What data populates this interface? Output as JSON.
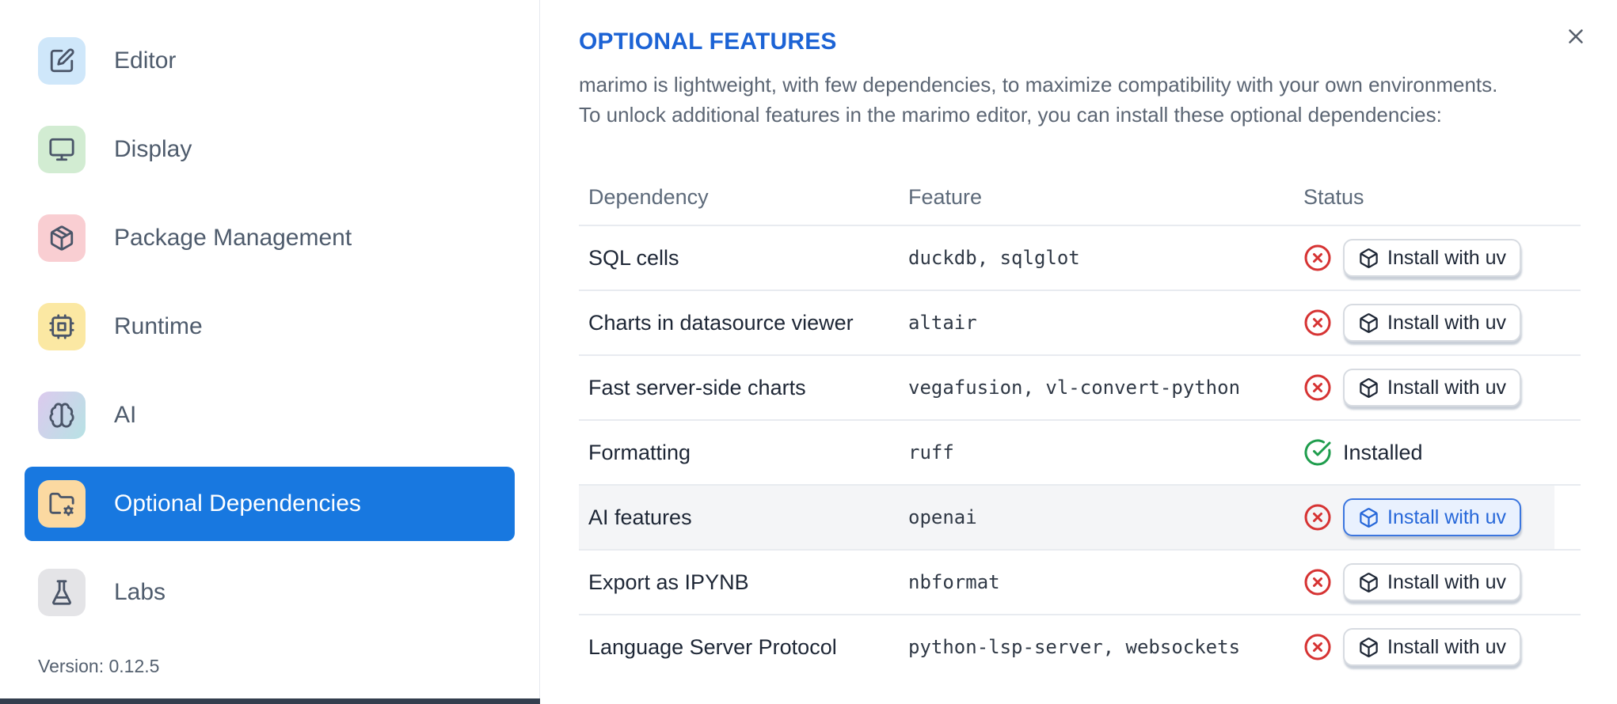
{
  "sidebar": {
    "items": [
      {
        "label": "Editor",
        "icon": "square-pen-icon",
        "icon_bg": "#cfe7fa",
        "selected": false
      },
      {
        "label": "Display",
        "icon": "monitor-icon",
        "icon_bg": "#d2ecd2",
        "selected": false
      },
      {
        "label": "Package Management",
        "icon": "package-icon",
        "icon_bg": "#f9ced2",
        "selected": false
      },
      {
        "label": "Runtime",
        "icon": "cpu-icon",
        "icon_bg": "#fbe8a3",
        "selected": false
      },
      {
        "label": "AI",
        "icon": "brain-icon",
        "icon_bg": "linear-gradient(120deg,#dccaee 0%,#b7e2e4 100%)",
        "selected": false
      },
      {
        "label": "Optional Dependencies",
        "icon": "folder-cog-icon",
        "icon_bg": "#fbd9a1",
        "selected": true
      },
      {
        "label": "Labs",
        "icon": "flask-icon",
        "icon_bg": "#e4e4e7",
        "selected": false
      }
    ],
    "version_label": "Version: 0.12.5",
    "selected_color": "#1878e0"
  },
  "panel": {
    "title": "OPTIONAL FEATURES",
    "description_lines": [
      "marimo is lightweight, with few dependencies, to maximize compatibility with your own environments.",
      "To unlock additional features in the marimo editor, you can install these optional dependencies:"
    ]
  },
  "table": {
    "columns": [
      "Dependency",
      "Feature",
      "Status"
    ],
    "install_button_label": "Install with uv",
    "installed_label": "Installed",
    "rows": [
      {
        "dependency": "SQL cells",
        "feature": "duckdb, sqlglot",
        "installed": false,
        "highlighted": false
      },
      {
        "dependency": "Charts in datasource viewer",
        "feature": "altair",
        "installed": false,
        "highlighted": false
      },
      {
        "dependency": "Fast server-side charts",
        "feature": "vegafusion, vl-convert-python",
        "installed": false,
        "highlighted": false
      },
      {
        "dependency": "Formatting",
        "feature": "ruff",
        "installed": true,
        "highlighted": false
      },
      {
        "dependency": "AI features",
        "feature": "openai",
        "installed": false,
        "highlighted": true
      },
      {
        "dependency": "Export as IPYNB",
        "feature": "nbformat",
        "installed": false,
        "highlighted": false
      },
      {
        "dependency": "Language Server Protocol",
        "feature": "python-lsp-server, websockets",
        "installed": false,
        "highlighted": false
      }
    ]
  },
  "colors": {
    "accent_blue": "#1878e0",
    "title_blue": "#1c63d5",
    "missing_red": "#d63333",
    "installed_green": "#1f9d4d"
  }
}
